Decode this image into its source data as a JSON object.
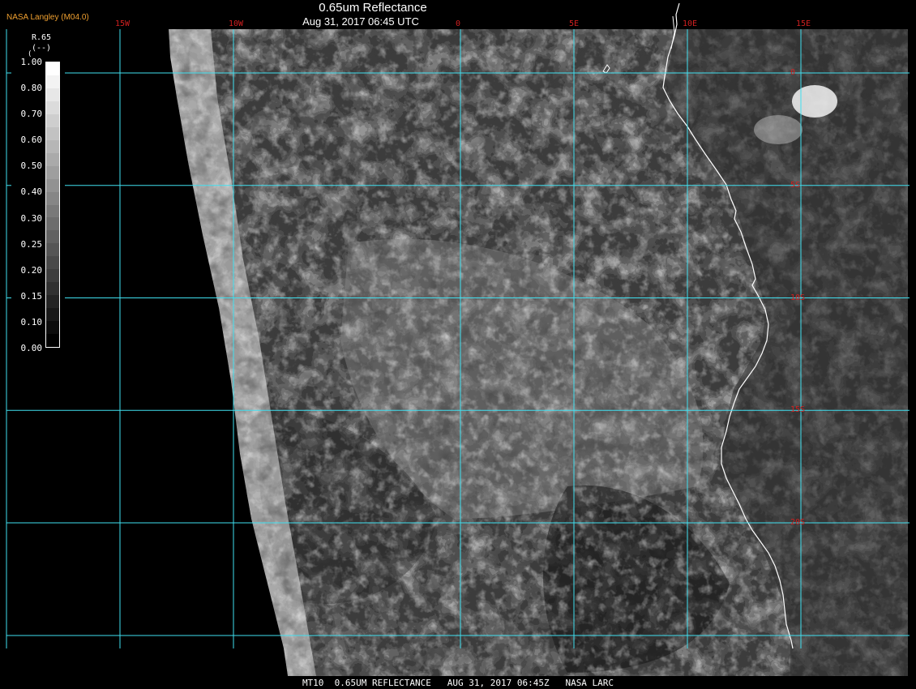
{
  "header": {
    "credit": "NASA Langley (M04.0)",
    "title": "0.65um Reflectance",
    "datetime": "Aug 31, 2017 06:45 UTC"
  },
  "grid": {
    "longitudes": [
      {
        "label": "15W",
        "value": -15
      },
      {
        "label": "10W",
        "value": -10
      },
      {
        "label": "0",
        "value": 0
      },
      {
        "label": "5E",
        "value": 5
      },
      {
        "label": "10E",
        "value": 10
      },
      {
        "label": "15E",
        "value": 15
      }
    ],
    "latitudes": [
      {
        "label": "0",
        "value": 0
      },
      {
        "label": "5S",
        "value": -5
      },
      {
        "label": "10S",
        "value": -10
      },
      {
        "label": "15S",
        "value": -15
      },
      {
        "label": "20S",
        "value": -20
      }
    ],
    "line_color": "#40e0f0"
  },
  "legend": {
    "title": "R.65",
    "units": "(--)",
    "corner_mark": "(",
    "ticks": [
      "1.00",
      "0.80",
      "0.70",
      "0.60",
      "0.50",
      "0.40",
      "0.30",
      "0.25",
      "0.20",
      "0.15",
      "0.10",
      "0.00"
    ]
  },
  "footer": {
    "text": "MT10  0.65UM REFLECTANCE   AUG 31, 2017 06:45Z   NASA LARC"
  },
  "colors": {
    "background": "#000000",
    "credit": "#f0a030",
    "coord_label": "#d02020",
    "coastline": "#ffffff"
  }
}
